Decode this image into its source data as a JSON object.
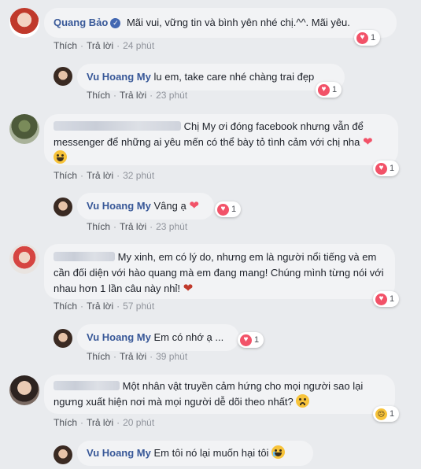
{
  "actions": {
    "like": "Thích",
    "reply": "Trả lời",
    "sep": "·"
  },
  "comments": [
    {
      "name": "Quang Bảo",
      "verified": true,
      "text": "Mãi vui, vững tin và bình yên nhé chị.^^. Mãi yêu.",
      "time": "24 phút",
      "reactions": "1"
    },
    {
      "name": "Vu Hoang My",
      "text": "lu em, take care nhé chàng trai đẹp",
      "time": "23 phút",
      "reactions": "1"
    },
    {
      "name": "",
      "text": "Chị My ơi đóng facebook nhưng vẫn để messenger để những ai yêu mến có thể bày tỏ tình cảm với chị nha",
      "time": "32 phút",
      "reactions": "1"
    },
    {
      "name": "Vu Hoang My",
      "text": "Vâng ạ",
      "time": "23 phút",
      "reactions": "1"
    },
    {
      "name": "",
      "text": "My xinh, em có lý do, nhưng em là người nổi tiếng và em cần đối diện với hào quang mà em đang mang! Chúng mình từng nói với nhau hơn 1 lần câu này nhỉ!",
      "time": "57 phút",
      "reactions": "1"
    },
    {
      "name": "Vu Hoang My",
      "text": "Em có nhớ ạ ...",
      "time": "39 phút",
      "reactions": "1"
    },
    {
      "name": "",
      "text": "Một nhân vật truyền cảm hứng cho mọi người sao lại ngưng xuất hiện nơi mà mọi người dễ dõi theo nhất?",
      "time": "20 phút",
      "reactions": "1"
    },
    {
      "name": "Vu Hoang My",
      "text": "Em tôi nó lại muốn hại tôi"
    }
  ],
  "colors": {
    "name": "#385898",
    "bubble": "#f2f3f5",
    "heart": "#f25268"
  }
}
